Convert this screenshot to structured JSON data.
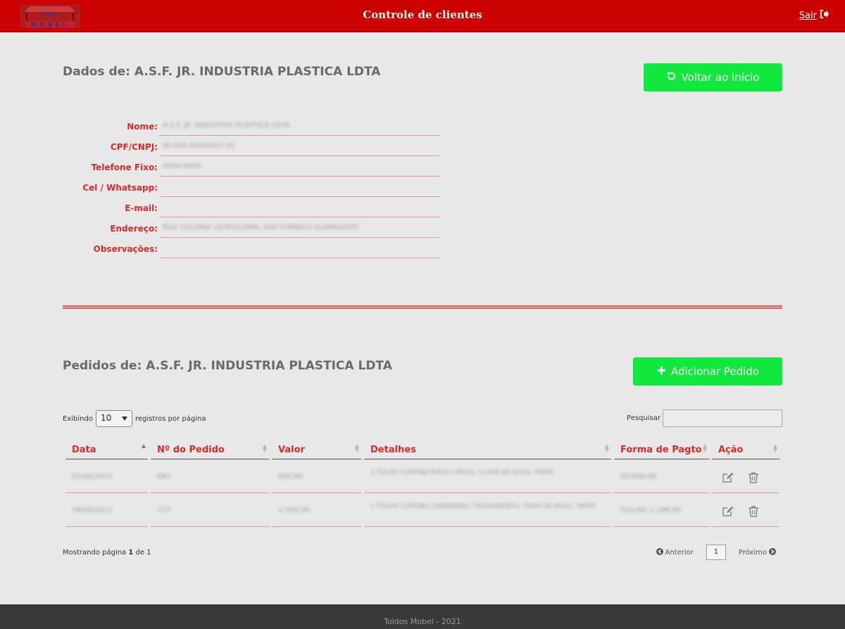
{
  "header": {
    "title": "Controle de clientes",
    "logout_label": "Sair",
    "logo_text_top": "Toldos",
    "logo_text_bottom": "MOBEL"
  },
  "client": {
    "section_title": "Dados de: A.S.F. JR. INDUSTRIA PLASTICA LDTA",
    "back_button": "Voltar ao início",
    "fields": [
      {
        "label": "Nome:",
        "value": "A.S.F. JR. INDUSTRIA PLASTICA LDTA"
      },
      {
        "label": "CPF/CNPJ:",
        "value": "00.000.000/0001-00"
      },
      {
        "label": "Telefone Fixo:",
        "value": "0000-0000"
      },
      {
        "label": "Cel / Whatsapp:",
        "value": ""
      },
      {
        "label": "E-mail:",
        "value": ""
      },
      {
        "label": "Endereço:",
        "value": "RUA COLONIA LEOPOLDINA, 000 CUMBICA GUARULHOS"
      },
      {
        "label": "Observações:",
        "value": ""
      }
    ]
  },
  "orders": {
    "section_title": "Pedidos de: A.S.F. JR. INDUSTRIA PLASTICA LDTA",
    "add_button": "Adicionar Pedido",
    "length_prefix": "Exibindo",
    "length_value": "10",
    "length_suffix": "registros por página",
    "search_label": "Pesquisar",
    "columns": [
      "Data",
      "Nº do Pedido",
      "Valor",
      "Detalhes",
      "Forma de Pagto",
      "Ação"
    ],
    "rows": [
      {
        "data": "01/06/2011",
        "pedido": "081",
        "valor": "600,00",
        "detalhes": "1 TOLDO CORTINA ROLO C/ROLO, CLOSE DE NOVA / MATE",
        "pagto": "20,000,00"
      },
      {
        "data": "16/08/2011",
        "pedido": "177",
        "valor": "1.700,00",
        "detalhes": "1 TOLDO CORTINA C/ENGRENA / FECHAMENTO, TUDO DE ROLO / MATE",
        "pagto": "510,00/ 1.190,00"
      }
    ],
    "info_prefix": "Mostrando página",
    "info_page": "1",
    "info_mid": "de",
    "info_total": "1",
    "prev_label": "Anterior",
    "page_number": "1",
    "next_label": "Próximo"
  },
  "footer": {
    "text": "Toldos Mobel - 2021"
  },
  "colors": {
    "header_bg": "#cc0000",
    "accent_red": "#d72b2b",
    "button_green": "#11e83e",
    "background": "#e8e8e8",
    "footer_bg": "#3a3a3a"
  }
}
